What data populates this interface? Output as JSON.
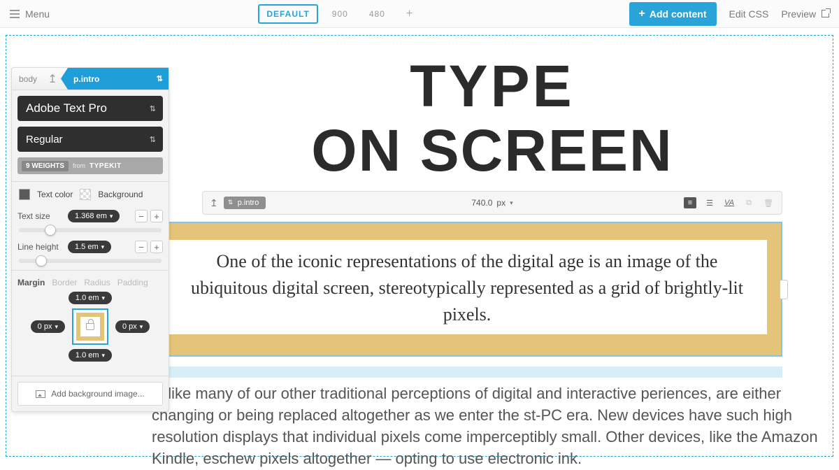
{
  "topbar": {
    "menu": "Menu",
    "breakpoints": {
      "default": "DEFAULT",
      "bp1": "900",
      "bp2": "480"
    },
    "addContent": "Add content",
    "editCss": "Edit CSS",
    "preview": "Preview"
  },
  "panel": {
    "crumb": {
      "root": "body",
      "selected": "p.intro"
    },
    "fontFamily": "Adobe Text Pro",
    "fontStyle": "Regular",
    "weights": {
      "count": "9 WEIGHTS",
      "from": "from",
      "kit": "TYPEKIT"
    },
    "textColorLabel": "Text color",
    "backgroundLabel": "Background",
    "textSize": {
      "label": "Text size",
      "value": "1.368 em"
    },
    "lineHeight": {
      "label": "Line height",
      "value": "1.5 em"
    },
    "tabs": {
      "margin": "Margin",
      "border": "Border",
      "radius": "Radius",
      "padding": "Padding"
    },
    "margins": {
      "top": "1.0 em",
      "right": "0 px",
      "bottom": "1.0 em",
      "left": "0 px"
    },
    "addBg": "Add background image..."
  },
  "elementBar": {
    "selector": "p.intro",
    "width": "740.0",
    "unit": "px"
  },
  "content": {
    "titleLine1": "TYPE",
    "titleLine2": "ON SCREEN",
    "intro": "One of the iconic representations of the digital age is an image of the ubiquitous digital screen, stereotypically represented as a grid of brightly-lit pixels.",
    "body": "s, like many of our other traditional perceptions of digital and interactive periences, are either changing or being replaced altogether as we enter the st-PC era. New devices have such high resolution displays that individual pixels come imperceptibly small. Other devices, like the Amazon Kindle, eschew pixels altogether — opting to use electronic ink."
  }
}
